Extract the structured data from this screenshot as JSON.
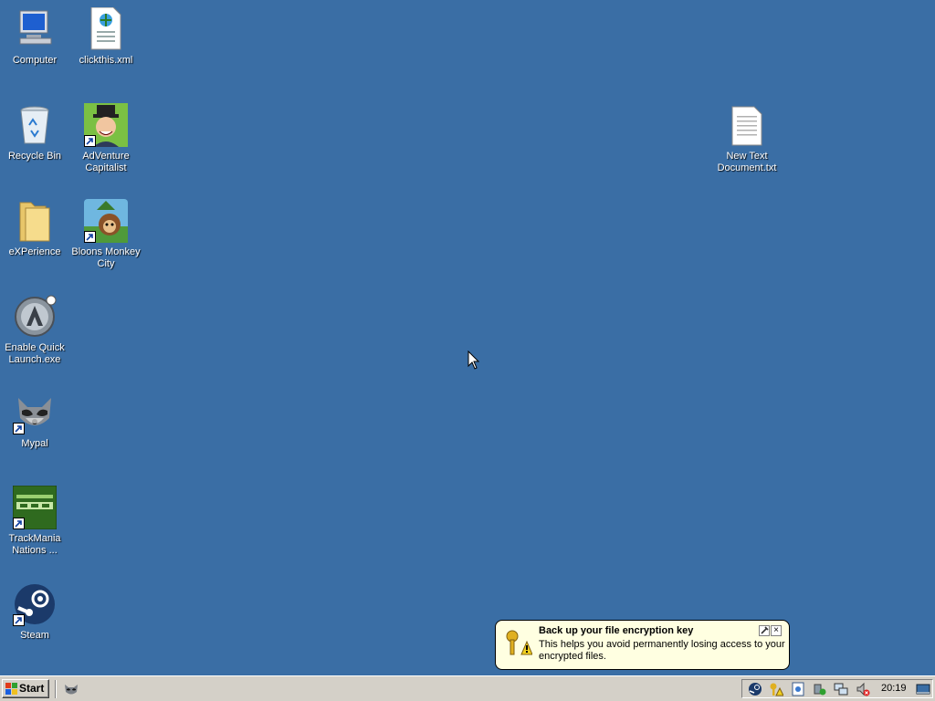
{
  "desktop": {
    "icons": [
      {
        "label": "Computer"
      },
      {
        "label": "clickthis.xml"
      },
      {
        "label": "Recycle Bin"
      },
      {
        "label": "AdVenture Capitalist"
      },
      {
        "label": "eXPerience"
      },
      {
        "label": "Bloons Monkey City"
      },
      {
        "label": "Enable Quick Launch.exe"
      },
      {
        "label": "Mypal"
      },
      {
        "label": "TrackMania Nations ..."
      },
      {
        "label": "Steam"
      },
      {
        "label": "New Text Document.txt"
      }
    ]
  },
  "taskbar": {
    "start_label": "Start",
    "clock": "20:19"
  },
  "balloon": {
    "title": "Back up your file encryption key",
    "text": "This helps you avoid permanently losing access to your encrypted files.",
    "close_glyph": "×"
  },
  "colors": {
    "desktop_bg": "#3a6ea5",
    "taskbar_bg": "#d4d0c8",
    "balloon_bg": "#ffffe1"
  }
}
